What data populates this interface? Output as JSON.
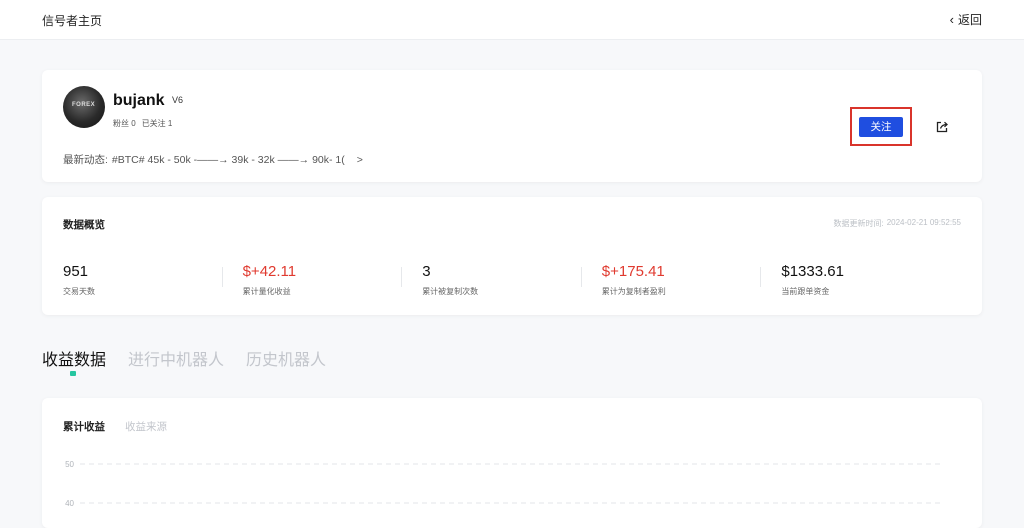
{
  "header": {
    "title": "信号者主页",
    "back_label": "返回"
  },
  "profile": {
    "avatar_text": "FOREX",
    "username": "bujank",
    "badge": "V6",
    "fans_label": "粉丝",
    "fans_count": "0",
    "following_label": "已关注",
    "following_count": "1",
    "news_label": "最新动态:",
    "news_text": "#BTC# 45k - 50k -——→ 39k - 32k ——→ 90k- 1(",
    "news_more": ">",
    "follow_label": "关注",
    "colors": {
      "follow_button": "#1f4ee0",
      "highlight_box": "#d9342b"
    }
  },
  "overview": {
    "title": "数据概览",
    "update_label": "数据更新时间:",
    "update_time": "2024-02-21 09:52:55",
    "stats": [
      {
        "value": "951",
        "label": "交易天数",
        "color": "#111111"
      },
      {
        "value": "$+42.11",
        "label": "累计量化收益",
        "color": "#e03a2f"
      },
      {
        "value": "3",
        "label": "累计被复制次数",
        "color": "#111111"
      },
      {
        "value": "$+175.41",
        "label": "累计为复制者盈利",
        "color": "#e03a2f"
      },
      {
        "value": "$1333.61",
        "label": "当前跟单资金",
        "color": "#111111"
      }
    ]
  },
  "tabs": [
    {
      "label": "收益数据",
      "active": true
    },
    {
      "label": "进行中机器人",
      "active": false
    },
    {
      "label": "历史机器人",
      "active": false
    }
  ],
  "chart_card": {
    "subtabs": [
      {
        "label": "累计收益",
        "active": true
      },
      {
        "label": "收益来源",
        "active": false
      }
    ]
  },
  "chart_data": {
    "type": "line",
    "title": "",
    "xlabel": "",
    "ylabel": "",
    "y_ticks": [
      50,
      40
    ],
    "ylim": [
      40,
      50
    ],
    "grid": true
  }
}
